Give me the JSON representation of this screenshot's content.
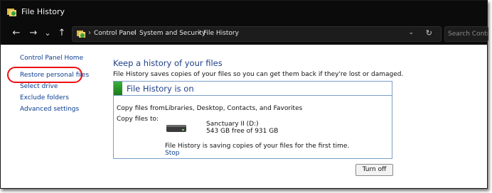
{
  "window": {
    "title": "File History"
  },
  "nav": {
    "back": "←",
    "forward": "→",
    "recent": "⌄",
    "up": "↑",
    "breadcrumb": [
      "Control Panel",
      "System and Security",
      "File History"
    ],
    "search_placeholder": "Search Control Panel"
  },
  "sidebar": {
    "items": [
      {
        "label": "Control Panel Home"
      },
      {
        "label": "Restore personal files"
      },
      {
        "label": "Select drive"
      },
      {
        "label": "Exclude folders"
      },
      {
        "label": "Advanced settings"
      }
    ]
  },
  "main": {
    "heading": "Keep a history of your files",
    "description": "File History saves copies of your files so you can get them back if they're lost or damaged.",
    "status_title": "File History is on",
    "copy_from_label": "Copy files from:",
    "copy_from_value": "Libraries, Desktop, Contacts, and Favorites",
    "copy_to_label": "Copy files to:",
    "drive_name": "Sanctuary II (D:)",
    "drive_space": "543 GB free of 931 GB",
    "progress_message": "File History is saving copies of your files for the first time.",
    "stop_link": "Stop",
    "turn_off_button": "Turn off"
  },
  "colors": {
    "accent_green": "#2e9a2e",
    "link": "#0b3d91",
    "heading": "#1e3f87",
    "annotation": "#e11111"
  }
}
